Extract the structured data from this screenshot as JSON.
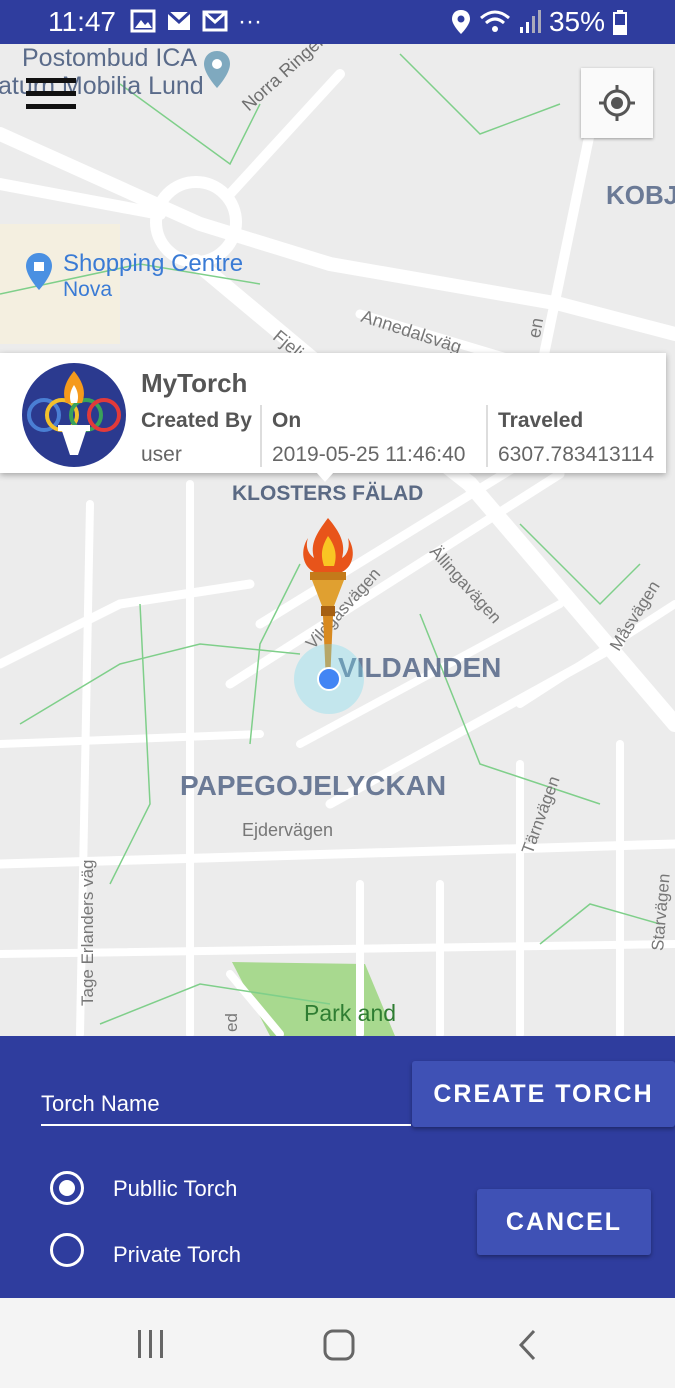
{
  "status_bar": {
    "time": "11:47",
    "notification_icons": [
      "image-icon",
      "email-icon",
      "gmail-icon",
      "more-icon"
    ],
    "more": "···",
    "battery": "35%"
  },
  "map": {
    "labels": {
      "postombud": "Postombud ICA",
      "mobilia": "aturn Mobilia Lund",
      "norra_ringen": "Norra Ringen",
      "kobj": "KOBJ",
      "shopping_centre": "Shopping Centre",
      "nova": "Nova",
      "annedalsvagen": "Annedalsväg",
      "fjeli": "Fjeli",
      "en": "en",
      "klosters_falad": "KLOSTERS FÄLAD",
      "vildasvagen": "Vildgasvägen",
      "allingavagen": "Ällingavägen",
      "masvagen": "Måsvägen",
      "vildanden": "VILDANDEN",
      "papegojelyckan": "PAPEGOJELYCKAN",
      "ejdervagen": "Ejdervägen",
      "tarnvagen": "Tärnvägen",
      "tage_erlanders": "Tage Erlanders väg",
      "starvagen": "Starvägen",
      "park_and": "Park and",
      "ed": "ed"
    }
  },
  "info_card": {
    "title": "MyTorch",
    "created_by_label": "Created By",
    "created_by_value": "user",
    "on_label": "On",
    "on_value": "2019-05-25 11:46:40",
    "traveled_label": "Traveled",
    "traveled_value": "6307.783413114"
  },
  "form": {
    "torch_name_placeholder": "Torch Name",
    "create_button": "CREATE TORCH",
    "cancel_button": "CANCEL",
    "public_option": "Publlic Torch",
    "private_option": "Private Torch",
    "selected": "public"
  },
  "colors": {
    "primary": "#2f3d9e",
    "button": "#3f51b5",
    "park": "#a8d98f",
    "user_location": "#4285f4"
  }
}
